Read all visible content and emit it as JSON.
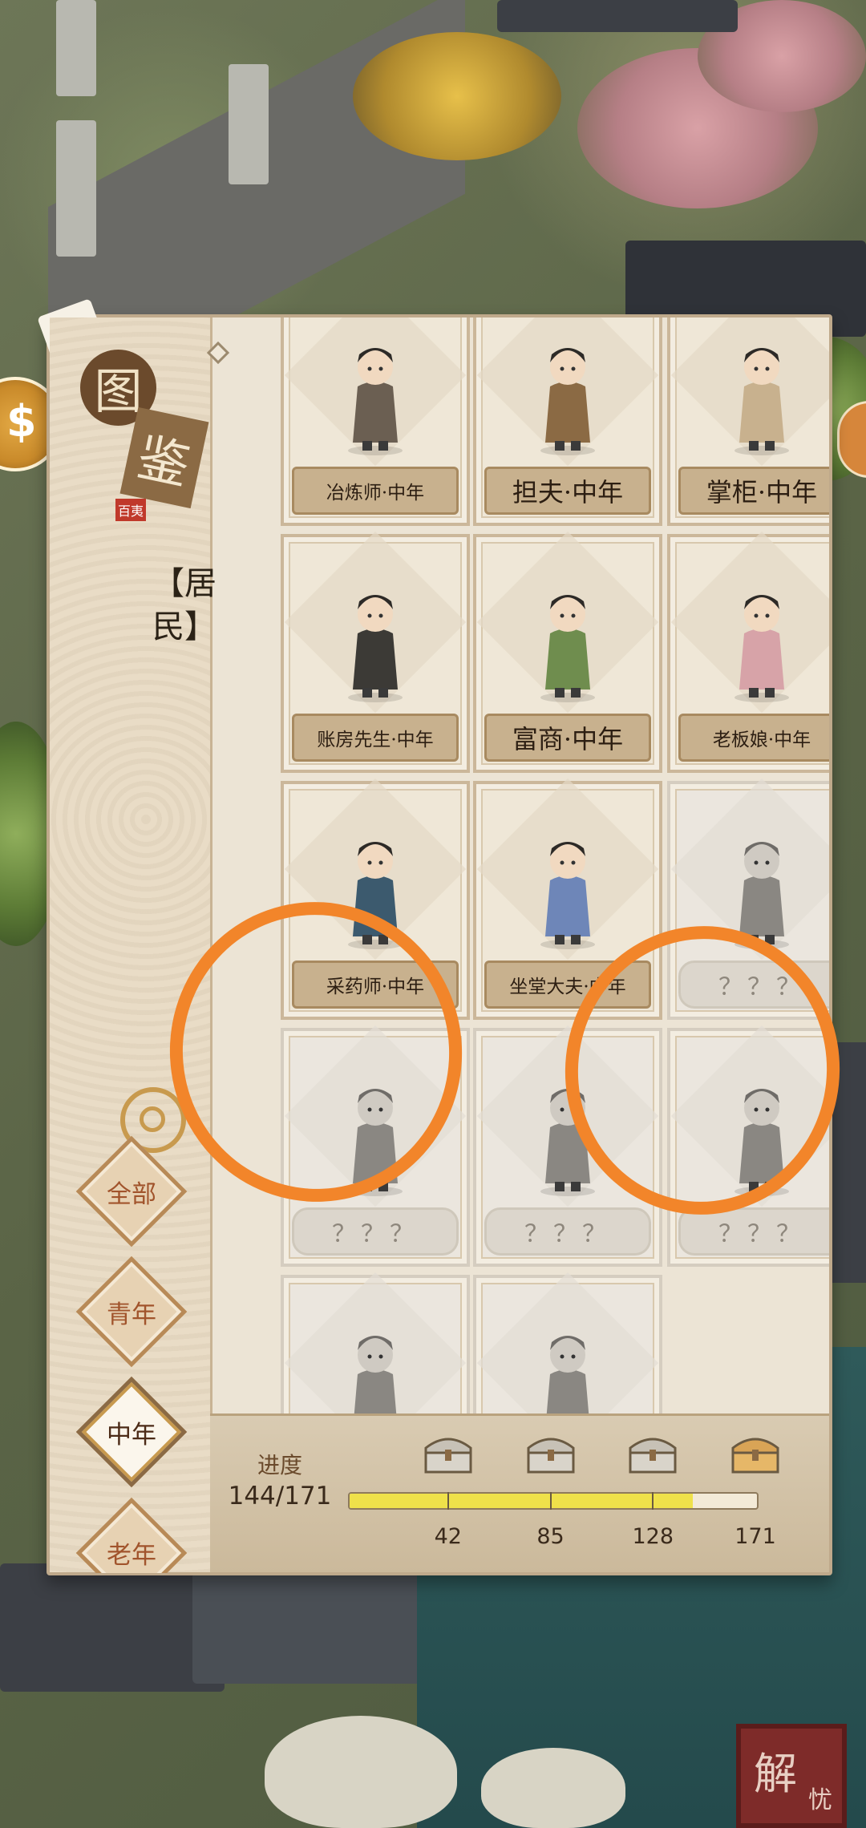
{
  "logo": {
    "line1": "图",
    "line2": "鉴",
    "stamp": "百夷"
  },
  "category_label": "【居民】",
  "tabs": [
    {
      "label": "全部",
      "active": false
    },
    {
      "label": "青年",
      "active": false
    },
    {
      "label": "中年",
      "active": true
    },
    {
      "label": "老年",
      "active": false
    }
  ],
  "cards": [
    {
      "name": "冶炼师·中年",
      "locked": false
    },
    {
      "name": "担夫·中年",
      "locked": false
    },
    {
      "name": "掌柜·中年",
      "locked": false
    },
    {
      "name": "账房先生·中年",
      "locked": false
    },
    {
      "name": "富商·中年",
      "locked": false
    },
    {
      "name": "老板娘·中年",
      "locked": false
    },
    {
      "name": "采药师·中年",
      "locked": false
    },
    {
      "name": "坐堂大夫·中年",
      "locked": false
    },
    {
      "name": "？？？",
      "locked": true
    },
    {
      "name": "？？？",
      "locked": true
    },
    {
      "name": "？？？",
      "locked": true
    },
    {
      "name": "？？？",
      "locked": true
    },
    {
      "name": "？？？",
      "locked": true
    },
    {
      "name": "？？？",
      "locked": true
    }
  ],
  "progress": {
    "label": "进度",
    "value_text": "144/171",
    "current": 144,
    "max": 171,
    "milestones": [
      "42",
      "85",
      "128",
      "171"
    ]
  },
  "colors": {
    "accent": "#f2852a",
    "progress_fill": "#efe14a"
  },
  "corner_button": {
    "line1": "解",
    "line2": "忧"
  }
}
